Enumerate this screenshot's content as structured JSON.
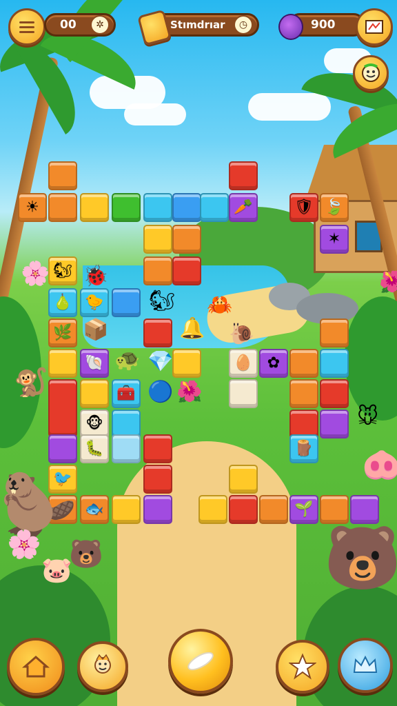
{
  "hud": {
    "menu_icon": "menu-icon",
    "moves_value": "00",
    "moves_icon": "gear-icon",
    "title_text": "Stımdrıar",
    "title_icon": "clock-icon",
    "coins_value": "900",
    "coins_icon": "gem-bag-icon",
    "map_icon": "map-icon",
    "helper_icon": "smiley-helper-icon"
  },
  "colors": {
    "orange": "#f28a2a",
    "yellow": "#ffc928",
    "green": "#3fbf2f",
    "cyan": "#3cc6f0",
    "blue": "#3a9ef2",
    "red": "#e53a2a",
    "purple": "#a14be0",
    "pale_blue": "#9fdcf5",
    "cream": "#f5ead0"
  },
  "bottom_bar": {
    "home_icon": "home-icon",
    "character_icon": "character-icon",
    "play_icon": "play-orb-icon",
    "star_icon": "star-icon",
    "crown_icon": "crown-icon"
  }
}
